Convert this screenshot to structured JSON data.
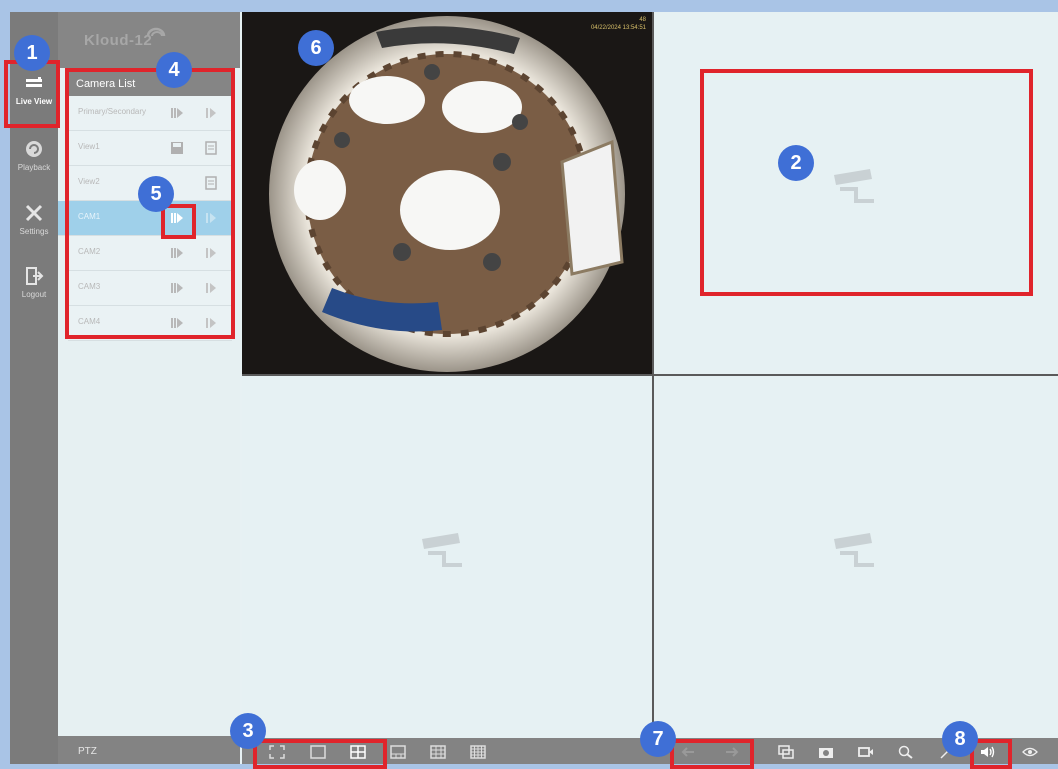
{
  "nav": {
    "items": [
      {
        "label": "Live View",
        "icon": "live-view-icon",
        "active": true
      },
      {
        "label": "Playback",
        "icon": "playback-icon"
      },
      {
        "label": "Settings",
        "icon": "settings-icon"
      },
      {
        "label": "Logout",
        "icon": "logout-icon"
      }
    ]
  },
  "sidebar": {
    "logo_text": "Kloud-12",
    "camera_list_title": "Camera List",
    "rows": [
      {
        "name": "Primary/Secondary"
      },
      {
        "name": "View1"
      },
      {
        "name": "View2"
      },
      {
        "name": "CAM1",
        "selected": true
      },
      {
        "name": "CAM2"
      },
      {
        "name": "CAM3"
      },
      {
        "name": "CAM4"
      }
    ],
    "ptz_label": "PTZ"
  },
  "video": {
    "feed1_date": "04/22/2024 13:54:51",
    "feed1_channel": "48"
  },
  "annotations": {
    "n1": "1",
    "n2": "2",
    "n3": "3",
    "n4": "4",
    "n5": "5",
    "n6": "6",
    "n7": "7",
    "n8": "8"
  },
  "colors": {
    "annotation_red": "#e0242b",
    "badge_blue": "#3f6fd6",
    "selected_row": "#9fd0ea",
    "rail_gray": "#7b7b7b"
  }
}
